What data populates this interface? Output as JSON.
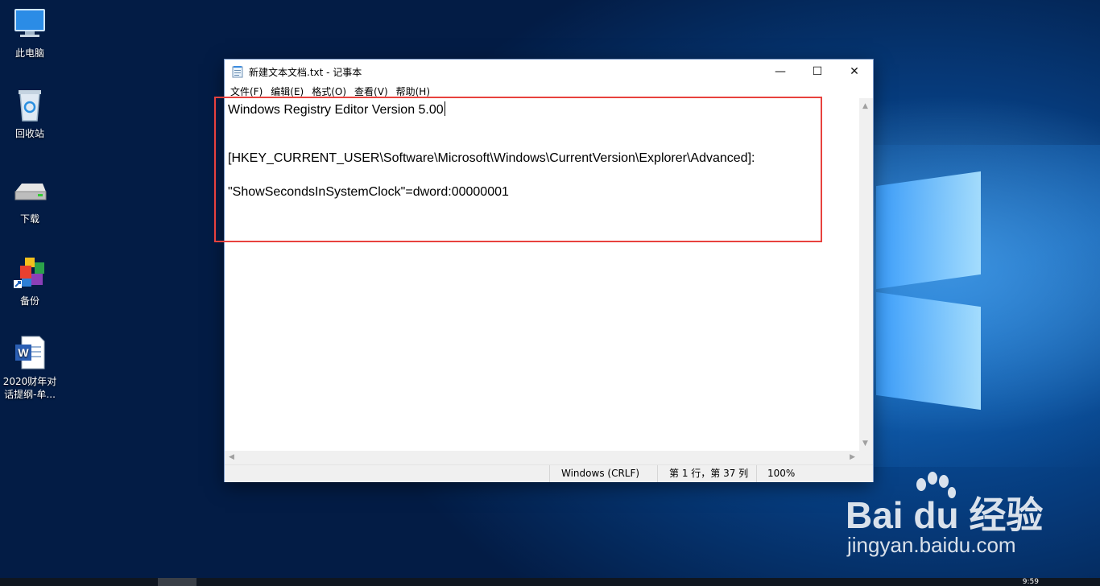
{
  "desktop": {
    "icons": [
      {
        "label": "此电脑"
      },
      {
        "label": "回收站"
      },
      {
        "label": "下载"
      },
      {
        "label": "备份"
      },
      {
        "label_line1": "2020财年对",
        "label_line2": "话提纲-牟..."
      }
    ]
  },
  "notepad": {
    "title": "新建文本文档.txt - 记事本",
    "menu": [
      "文件(F)",
      "编辑(E)",
      "格式(O)",
      "查看(V)",
      "帮助(H)"
    ],
    "lines": [
      "Windows Registry Editor Version 5.00",
      "[HKEY_CURRENT_USER\\Software\\Microsoft\\Windows\\CurrentVersion\\Explorer\\Advanced]:",
      "\"ShowSecondsInSystemClock\"=dword:00000001"
    ],
    "status": {
      "line_ending": "Windows (CRLF)",
      "position": "第 1 行，第 37 列",
      "zoom": "100%"
    }
  },
  "watermark": {
    "brand": "Bai du 经验",
    "site": "jingyan.baidu.com"
  },
  "taskbar": {
    "clock": "9:59"
  },
  "colors": {
    "highlight": "#e8423e",
    "desktop_blue": "#0b5fb6"
  }
}
